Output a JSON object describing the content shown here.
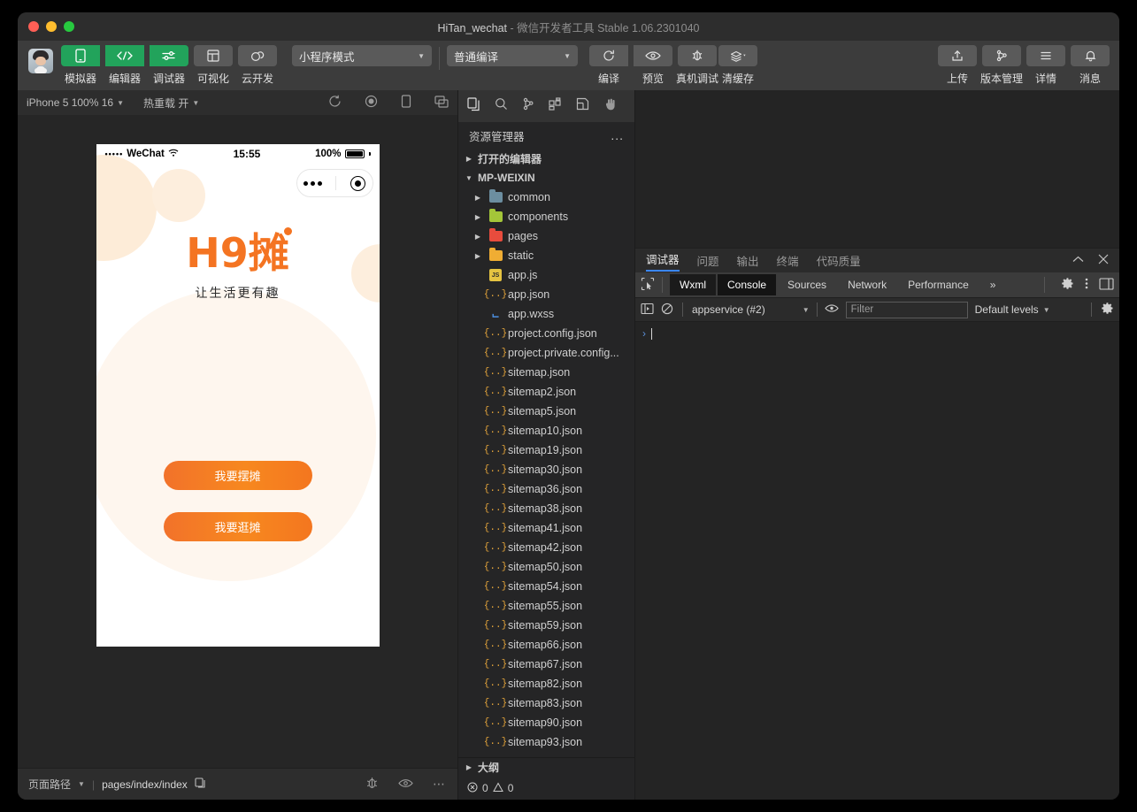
{
  "titlebar": {
    "app_name": "HiTan_wechat",
    "separator": " - ",
    "subtitle": "微信开发者工具 Stable 1.06.2301040"
  },
  "toolbar": {
    "mode_buttons": [
      {
        "label": "模拟器",
        "icon": "phone-icon",
        "style": "green"
      },
      {
        "label": "编辑器",
        "icon": "code-icon",
        "style": "green"
      },
      {
        "label": "调试器",
        "icon": "sliders-icon",
        "style": "green"
      },
      {
        "label": "可视化",
        "icon": "layout-icon",
        "style": "grey"
      },
      {
        "label": "云开发",
        "icon": "cloud-icon",
        "style": "grey"
      }
    ],
    "mode_select": "小程序模式",
    "compile_select": "普通编译",
    "action_buttons": [
      {
        "label": "编译",
        "icon": "refresh-icon"
      },
      {
        "label": "预览",
        "icon": "eye-icon"
      },
      {
        "label": "真机调试",
        "icon": "bug-icon"
      },
      {
        "label": "清缓存",
        "icon": "layers-icon"
      }
    ],
    "right_buttons": [
      {
        "label": "上传",
        "icon": "upload-icon"
      },
      {
        "label": "版本管理",
        "icon": "branch-icon"
      },
      {
        "label": "详情",
        "icon": "menu-icon"
      },
      {
        "label": "消息",
        "icon": "bell-icon"
      }
    ]
  },
  "simulator": {
    "device": "iPhone 5 100% 16",
    "hot_reload": "热重载 开",
    "icons": [
      "rotate-icon",
      "record-icon",
      "device-icon",
      "split-icon",
      "copy-icon",
      "search-icon",
      "branch-icon",
      "grid-icon",
      "panel-icon",
      "hand-icon"
    ],
    "phone": {
      "status": {
        "carrier": "WeChat",
        "signal_dots": "•••••",
        "time": "15:55",
        "battery": "100%"
      },
      "capsule": {
        "ellipsis": "•••",
        "target": "target-icon"
      },
      "logo_main": "H9摊",
      "logo_sub": "让生活更有趣",
      "buttons": [
        {
          "label": "我要摆摊"
        },
        {
          "label": "我要逛摊"
        }
      ]
    },
    "footer": {
      "route_label": "页面路径",
      "path": "pages/index/index",
      "icons": [
        "bug-icon",
        "eye-icon",
        "more-icon"
      ]
    }
  },
  "explorer": {
    "tab_icons": [
      "copy-icon",
      "search-icon",
      "branch-icon",
      "grid-icon",
      "panel-icon",
      "hand-icon"
    ],
    "title": "资源管理器",
    "more": "...",
    "sections": [
      {
        "label": "打开的编辑器",
        "expanded": false
      },
      {
        "label": "MP-WEIXIN",
        "expanded": true
      }
    ],
    "files": [
      {
        "name": "common",
        "type": "folder",
        "color": "#6c8ea0",
        "arrow": true
      },
      {
        "name": "components",
        "type": "folder",
        "color": "#a4c639",
        "arrow": true
      },
      {
        "name": "pages",
        "type": "folder",
        "color": "#e84c3d",
        "arrow": true
      },
      {
        "name": "static",
        "type": "folder",
        "color": "#f0ad33",
        "arrow": true
      },
      {
        "name": "app.js",
        "type": "js",
        "arrow": false
      },
      {
        "name": "app.json",
        "type": "json",
        "arrow": false
      },
      {
        "name": "app.wxss",
        "type": "wxss",
        "arrow": false
      },
      {
        "name": "project.config.json",
        "type": "json",
        "arrow": false
      },
      {
        "name": "project.private.config...",
        "type": "json",
        "arrow": false
      },
      {
        "name": "sitemap.json",
        "type": "json",
        "arrow": false
      },
      {
        "name": "sitemap2.json",
        "type": "json",
        "arrow": false
      },
      {
        "name": "sitemap5.json",
        "type": "json",
        "arrow": false
      },
      {
        "name": "sitemap10.json",
        "type": "json",
        "arrow": false
      },
      {
        "name": "sitemap19.json",
        "type": "json",
        "arrow": false
      },
      {
        "name": "sitemap30.json",
        "type": "json",
        "arrow": false
      },
      {
        "name": "sitemap36.json",
        "type": "json",
        "arrow": false
      },
      {
        "name": "sitemap38.json",
        "type": "json",
        "arrow": false
      },
      {
        "name": "sitemap41.json",
        "type": "json",
        "arrow": false
      },
      {
        "name": "sitemap42.json",
        "type": "json",
        "arrow": false
      },
      {
        "name": "sitemap50.json",
        "type": "json",
        "arrow": false
      },
      {
        "name": "sitemap54.json",
        "type": "json",
        "arrow": false
      },
      {
        "name": "sitemap55.json",
        "type": "json",
        "arrow": false
      },
      {
        "name": "sitemap59.json",
        "type": "json",
        "arrow": false
      },
      {
        "name": "sitemap66.json",
        "type": "json",
        "arrow": false
      },
      {
        "name": "sitemap67.json",
        "type": "json",
        "arrow": false
      },
      {
        "name": "sitemap82.json",
        "type": "json",
        "arrow": false
      },
      {
        "name": "sitemap83.json",
        "type": "json",
        "arrow": false
      },
      {
        "name": "sitemap90.json",
        "type": "json",
        "arrow": false
      },
      {
        "name": "sitemap93.json",
        "type": "json",
        "arrow": false
      }
    ],
    "outline": "大纲",
    "status": {
      "errors": "0",
      "warnings": "0"
    }
  },
  "debugger": {
    "panel_tabs": [
      {
        "label": "调试器",
        "active": true
      },
      {
        "label": "问题",
        "active": false
      },
      {
        "label": "输出",
        "active": false
      },
      {
        "label": "终端",
        "active": false
      },
      {
        "label": "代码质量",
        "active": false
      }
    ],
    "panel_actions": [
      "collapse-icon",
      "close-icon"
    ],
    "devtools_tabs": [
      {
        "label": "Wxml",
        "active": false
      },
      {
        "label": "Console",
        "active": true
      },
      {
        "label": "Sources",
        "active": false
      },
      {
        "label": "Network",
        "active": false
      },
      {
        "label": "Performance",
        "active": false
      }
    ],
    "overflow": "»",
    "devtools_right_icons": [
      "gear-icon",
      "kebab-icon",
      "dock-icon"
    ],
    "console": {
      "context": "appservice (#2)",
      "filter_placeholder": "Filter",
      "levels": "Default levels",
      "prompt": "›"
    }
  }
}
